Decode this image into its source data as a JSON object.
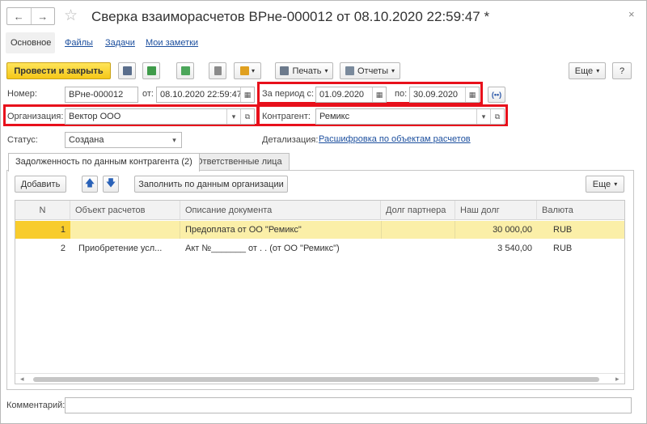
{
  "window": {
    "title": "Сверка взаиморасчетов ВРне-000012 от 08.10.2020 22:59:47 *",
    "back_glyph": "←",
    "forward_glyph": "→",
    "star_glyph": "☆",
    "close_glyph": "×"
  },
  "sections": {
    "main": "Основное",
    "files": "Файлы",
    "tasks": "Задачи",
    "notes": "Мои заметки"
  },
  "toolbar": {
    "post_close": "Провести и закрыть",
    "print": "Печать",
    "reports": "Отчеты",
    "more": "Еще",
    "help": "?",
    "dropdown_glyph": "▾"
  },
  "header": {
    "number_label": "Номер:",
    "number_value": "ВРне-000012",
    "date_label": "от:",
    "date_value": "08.10.2020 22:59:47",
    "period_label": "За период с:",
    "period_from": "01.09.2020",
    "period_to_label": "по:",
    "period_to": "30.09.2020",
    "org_label": "Организация:",
    "org_value": "Вектор ООО",
    "counterparty_label": "Контрагент:",
    "counterparty_value": "Ремикс",
    "status_label": "Статус:",
    "status_value": "Создана",
    "detail_label": "Детализация:",
    "detail_value": "Расшифровка по объектам расчетов"
  },
  "tabs": {
    "debt": "Задолженность по данным контрагента (2)",
    "responsible": "Ответственные лица"
  },
  "table_toolbar": {
    "add": "Добавить",
    "fill": "Заполнить по данным организации",
    "more": "Еще"
  },
  "table": {
    "columns": [
      "N",
      "Объект расчетов",
      "Описание документа",
      "Долг партнера",
      "Наш долг",
      "Валюта"
    ],
    "rows": [
      {
        "n": "1",
        "object": "",
        "description": "Предоплата от ОО \"Ремикс\"",
        "partner_debt": "",
        "our_debt": "30 000,00",
        "currency": "RUB"
      },
      {
        "n": "2",
        "object": "Приобретение усл...",
        "description": "Акт №_______ от   .   .     (от ОО \"Ремикс\")",
        "partner_debt": "",
        "our_debt": "3 540,00",
        "currency": "RUB"
      }
    ]
  },
  "comment": {
    "label": "Комментарий:",
    "value": ""
  },
  "colors": {
    "primary_button": "#f5c718",
    "highlight_row": "#fbefa8",
    "selected_cell": "#f8cc2c",
    "annotation_red": "#e8101b",
    "link": "#1c4f9e"
  }
}
